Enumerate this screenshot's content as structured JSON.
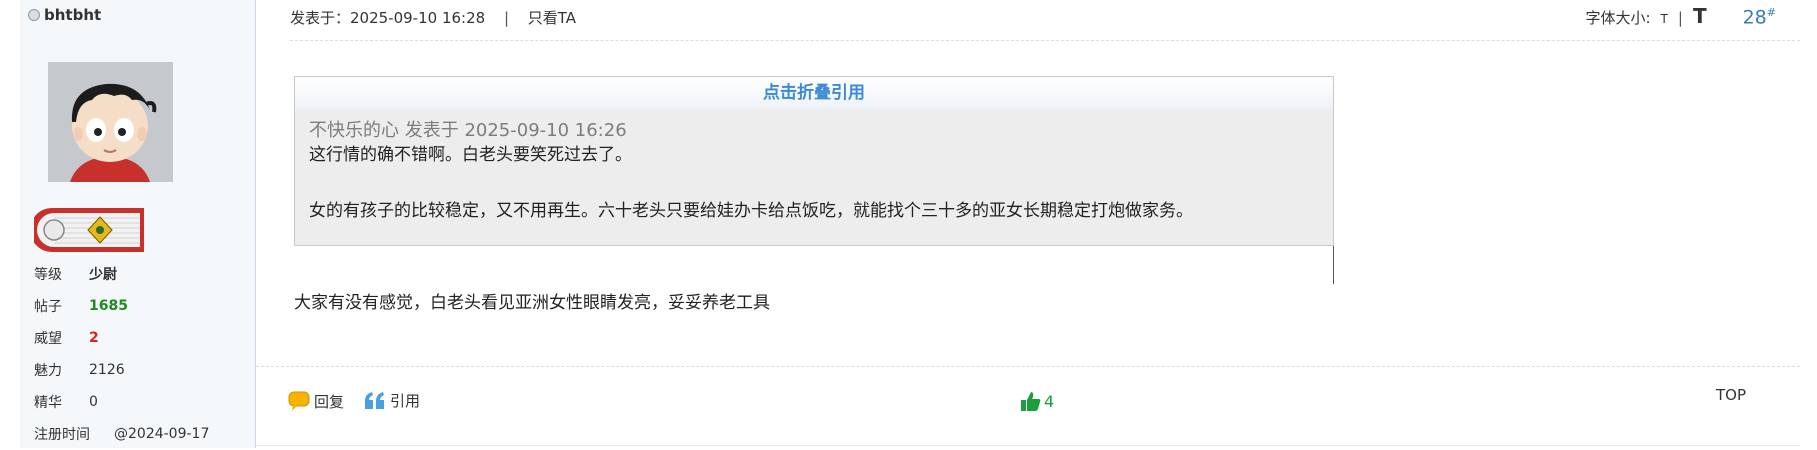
{
  "user": {
    "name": "bhtbht",
    "stats": [
      {
        "label": "等级",
        "value": "少尉",
        "style": "bold"
      },
      {
        "label": "帖子",
        "value": "1685",
        "style": "green"
      },
      {
        "label": "威望",
        "value": "2",
        "style": "red"
      },
      {
        "label": "魅力",
        "value": "2126",
        "style": "plain"
      },
      {
        "label": "精华",
        "value": "0",
        "style": "plain"
      },
      {
        "label": "注册时间",
        "value": "@2024-09-17",
        "style": "plain"
      }
    ]
  },
  "post": {
    "posted_at": "发表于：2025-09-10 16:28",
    "separator": "|",
    "only_author": "只看TA",
    "font_size_label": "字体大小:",
    "font_small": "T",
    "font_sep": "|",
    "font_large": "T",
    "floor": "28",
    "floor_mark": "#"
  },
  "quote": {
    "toggle_label": "点击折叠引用",
    "header": "不快乐的心 发表于 2025-09-10 16:26",
    "line1": "这行情的确不错啊。白老头要笑死过去了。",
    "line2": "女的有孩子的比较稳定，又不用再生。六十老头只要给娃办卡给点饭吃，就能找个三十多的亚女长期稳定打炮做家务。"
  },
  "reply_text": "大家有没有感觉，白老头看见亚洲女性眼睛发亮，妥妥养老工具",
  "actions": {
    "reply": "回复",
    "quote": "引用",
    "like_count": "4",
    "top": "TOP"
  },
  "colors": {
    "link_blue": "#3a8ad4",
    "green": "#1e8a1e",
    "red": "#e0201a",
    "like_green": "#1aa03a"
  }
}
